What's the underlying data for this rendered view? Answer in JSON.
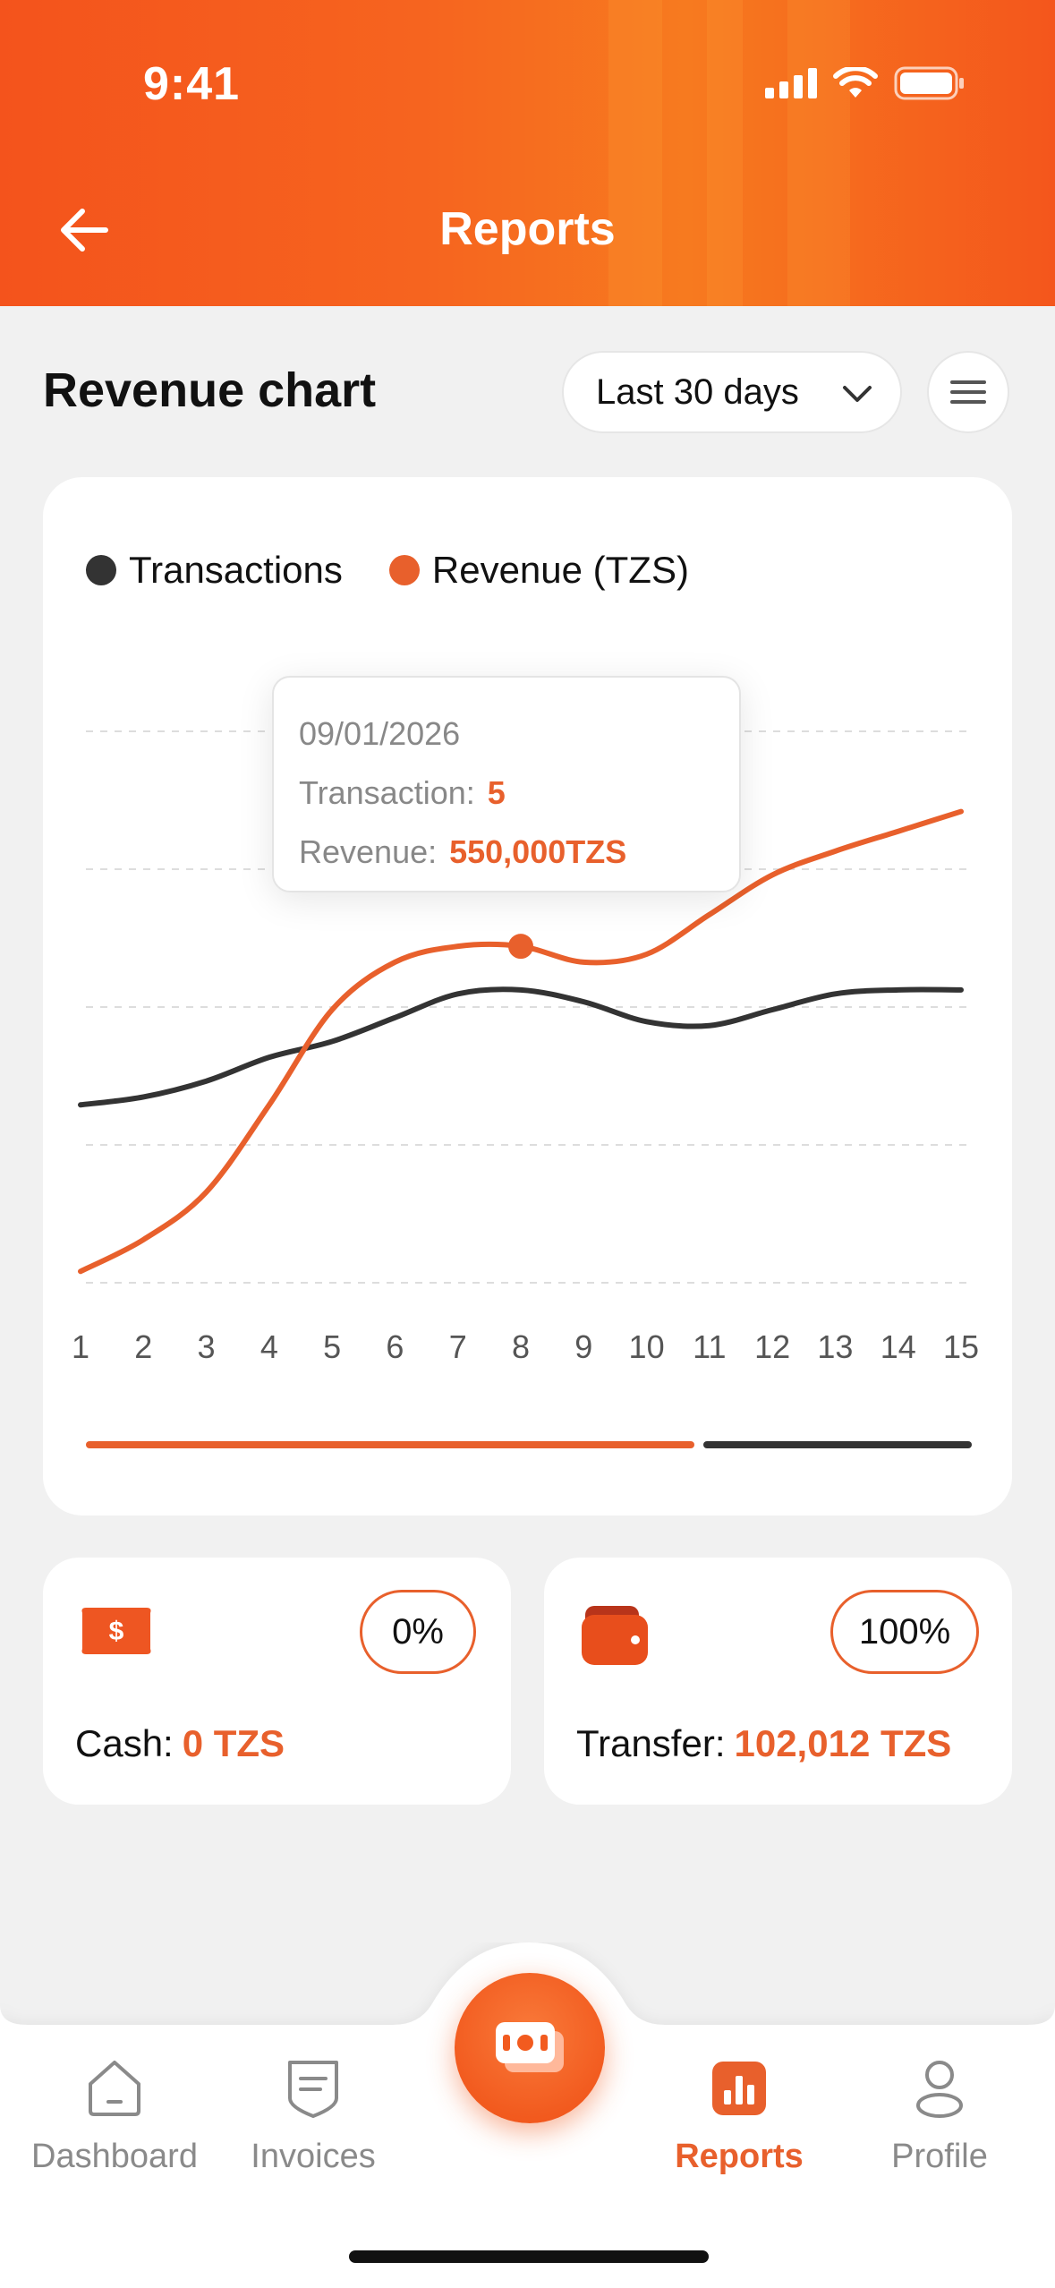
{
  "status_bar": {
    "time": "9:41"
  },
  "header": {
    "title": "Reports"
  },
  "section": {
    "title": "Revenue chart"
  },
  "range_select": {
    "value": "Last 30 days"
  },
  "legend": {
    "transactions": "Transactions",
    "revenue": "Revenue (TZS)"
  },
  "tooltip": {
    "date": "09/01/2026",
    "transaction_label": "Transaction:",
    "transaction_value": "5",
    "revenue_label": "Revenue:",
    "revenue_value": "550,000TZS"
  },
  "payments": {
    "cash": {
      "percent": "0%",
      "label": "Cash:",
      "amount": "0 TZS"
    },
    "transfer": {
      "percent": "100%",
      "label": "Transfer:",
      "amount": "102,012 TZS"
    }
  },
  "tabs": {
    "dashboard": "Dashboard",
    "invoices": "Invoices",
    "reports": "Reports",
    "profile": "Profile"
  },
  "colors": {
    "accent": "#e8602c",
    "dark": "#333333"
  },
  "chart_data": {
    "type": "line",
    "x": [
      1,
      2,
      3,
      4,
      5,
      6,
      7,
      8,
      9,
      10,
      11,
      12,
      13,
      14,
      15
    ],
    "series": [
      {
        "name": "Transactions",
        "color": "#333333",
        "values": [
          2.3,
          2.4,
          2.6,
          2.9,
          3.1,
          3.4,
          3.7,
          3.75,
          3.6,
          3.35,
          3.3,
          3.5,
          3.7,
          3.75,
          3.75
        ]
      },
      {
        "name": "Revenue (TZS)",
        "color": "#e8602c",
        "values": [
          0.2,
          0.6,
          1.2,
          2.3,
          3.5,
          4.1,
          4.3,
          4.3,
          4.1,
          4.2,
          4.7,
          5.2,
          5.5,
          5.75,
          6.0
        ]
      }
    ],
    "ylim": [
      0,
      7
    ],
    "grid": true,
    "legend": "top-left",
    "highlight": {
      "x": 8,
      "series": "Revenue (TZS)"
    }
  }
}
